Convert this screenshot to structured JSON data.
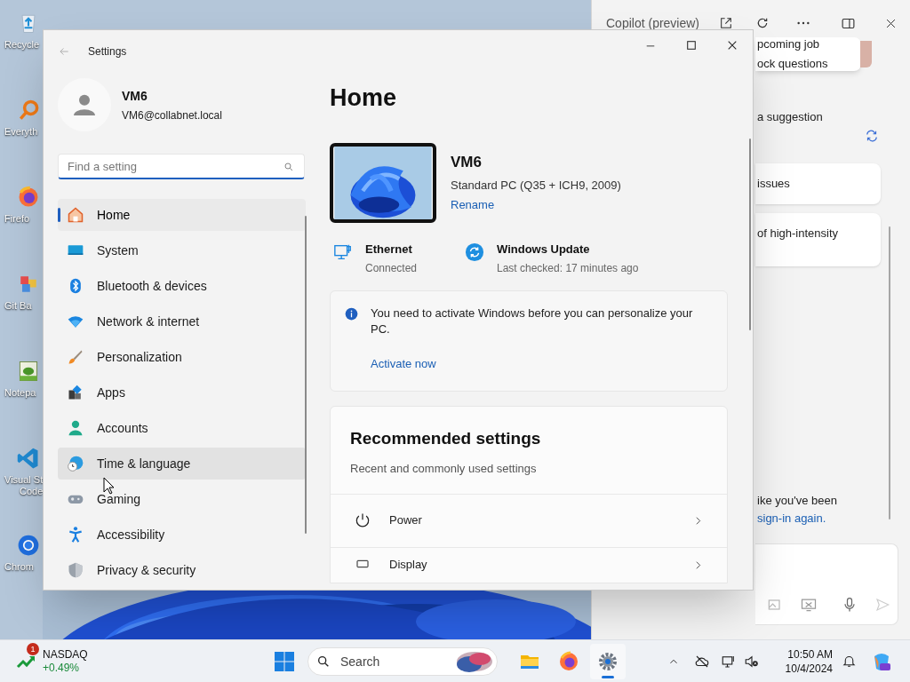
{
  "desktop": {
    "icons": [
      {
        "kind": "recycle",
        "lines": [
          "Recycle"
        ]
      },
      {
        "kind": "everything",
        "lines": [
          "Everyth"
        ]
      },
      {
        "kind": "firefox",
        "lines": [
          "Firefo"
        ]
      },
      {
        "kind": "git",
        "lines": [
          "Git Ba"
        ]
      },
      {
        "kind": "notepad",
        "lines": [
          "Notepa"
        ]
      },
      {
        "kind": "vscode",
        "lines": [
          "Visual St",
          "Code"
        ]
      },
      {
        "kind": "chrome",
        "lines": [
          "Chrom"
        ]
      }
    ]
  },
  "copilot": {
    "title": "Copilot (preview)",
    "snippets": [
      {
        "kind": "card",
        "lines": [
          "pcoming job",
          "ock questions"
        ]
      },
      {
        "kind": "text",
        "lines": [
          "a suggestion"
        ]
      },
      {
        "kind": "refresh"
      },
      {
        "kind": "card",
        "lines": [
          "issues"
        ]
      },
      {
        "kind": "card",
        "lines": [
          "of high-intensity"
        ]
      },
      {
        "kind": "notice",
        "text": "ike you've been",
        "link": "sign-in again."
      }
    ]
  },
  "settings": {
    "title": "Settings",
    "user": {
      "name": "VM6",
      "email": "VM6@collabnet.local"
    },
    "search": {
      "placeholder": "Find a setting"
    },
    "nav": [
      {
        "kind": "home",
        "label": "Home",
        "selected": true,
        "hovered": false
      },
      {
        "kind": "system",
        "label": "System",
        "selected": false,
        "hovered": false
      },
      {
        "kind": "bluetooth",
        "label": "Bluetooth & devices",
        "selected": false,
        "hovered": false
      },
      {
        "kind": "network",
        "label": "Network & internet",
        "selected": false,
        "hovered": false
      },
      {
        "kind": "brush",
        "label": "Personalization",
        "selected": false,
        "hovered": false
      },
      {
        "kind": "apps",
        "label": "Apps",
        "selected": false,
        "hovered": false
      },
      {
        "kind": "accounts",
        "label": "Accounts",
        "selected": false,
        "hovered": false
      },
      {
        "kind": "time",
        "label": "Time & language",
        "selected": false,
        "hovered": true
      },
      {
        "kind": "gaming",
        "label": "Gaming",
        "selected": false,
        "hovered": false
      },
      {
        "kind": "accessibility",
        "label": "Accessibility",
        "selected": false,
        "hovered": false
      },
      {
        "kind": "privacy",
        "label": "Privacy & security",
        "selected": false,
        "hovered": false
      }
    ],
    "page": {
      "heading": "Home",
      "device": {
        "name": "VM6",
        "model": "Standard PC (Q35 + ICH9, 2009)",
        "link": "Rename"
      },
      "status": [
        {
          "kind": "ethernet",
          "title": "Ethernet",
          "subtitle": "Connected"
        },
        {
          "kind": "update",
          "title": "Windows Update",
          "subtitle": "Last checked: 17 minutes ago"
        }
      ],
      "notice": {
        "text": "You need to activate Windows before you can personalize your PC.",
        "link": "Activate now"
      },
      "recommended": {
        "title": "Recommended settings",
        "subtitle": "Recent and commonly used settings",
        "items": [
          {
            "kind": "power",
            "label": "Power"
          },
          {
            "kind": "display",
            "label": "Display"
          }
        ]
      }
    }
  },
  "taskbar": {
    "widget": {
      "badge": "1",
      "name": "NASDAQ",
      "change": "+0.49%"
    },
    "search": {
      "placeholder": "Search"
    },
    "apps": [
      {
        "kind": "files",
        "active": false
      },
      {
        "kind": "firefox",
        "active": false
      },
      {
        "kind": "settings",
        "active": true
      }
    ],
    "time": "10:50 AM",
    "date": "10/4/2024"
  }
}
